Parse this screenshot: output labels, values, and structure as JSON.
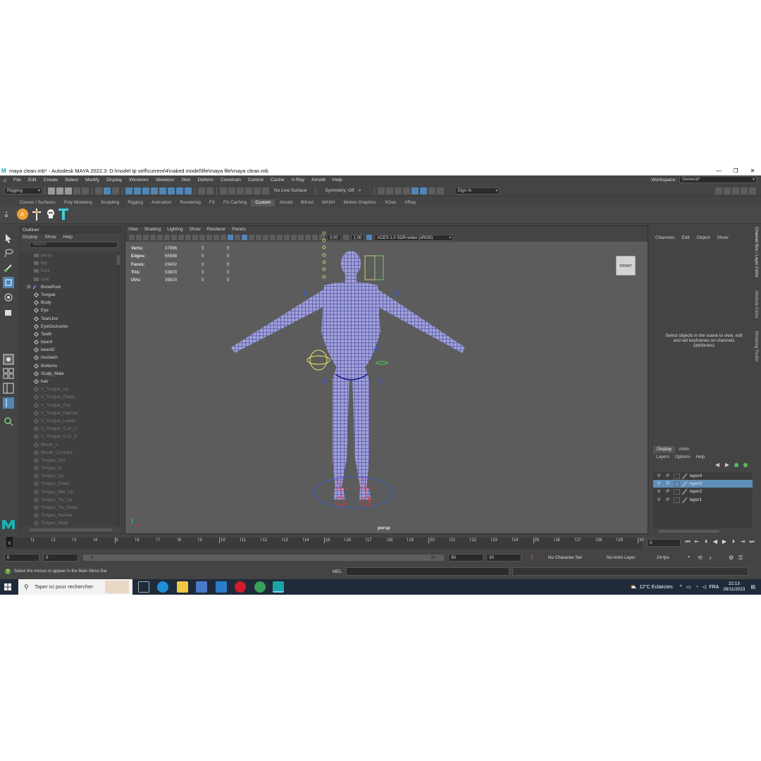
{
  "window": {
    "title": "maya clean.mb* - Autodesk MAYA 2022.3: D:\\model tp self\\current\\4\\naked model\\file\\maya file\\maya clean.mb",
    "controls": [
      "—",
      "❐",
      "✕"
    ]
  },
  "menubar": {
    "items": [
      "File",
      "Edit",
      "Create",
      "Select",
      "Modify",
      "Display",
      "Windows",
      "Skeleton",
      "Skin",
      "Deform",
      "Constrain",
      "Control",
      "Cache",
      "V-Ray",
      "Arnold",
      "Help"
    ],
    "workspace_label": "Workspace:",
    "workspace_value": "General*"
  },
  "statusline": {
    "menuset": "Rigging",
    "live_surface": "No Live Surface",
    "symmetry": "Symmetry: Off",
    "sign_in": "Sign In"
  },
  "shelf": {
    "tabs": [
      "Curves / Surfaces",
      "Poly Modeling",
      "Sculpting",
      "Rigging",
      "Animation",
      "Rendering",
      "FX",
      "FX Caching",
      "Custom",
      "Arnold",
      "Bifrost",
      "MASH",
      "Motion Graphics",
      "XGen",
      "VRay"
    ],
    "active_tab": "Custom"
  },
  "outliner": {
    "title": "Outliner",
    "menus": [
      "Display",
      "Show",
      "Help"
    ],
    "search_placeholder": "Search...",
    "items": [
      {
        "label": "persp",
        "kind": "camera",
        "dim": true
      },
      {
        "label": "top",
        "kind": "camera",
        "dim": true
      },
      {
        "label": "front",
        "kind": "camera",
        "dim": true
      },
      {
        "label": "side",
        "kind": "camera",
        "dim": true
      },
      {
        "label": "BoneRoot",
        "kind": "joint",
        "dim": false
      },
      {
        "label": "Tongue",
        "kind": "mesh",
        "dim": false
      },
      {
        "label": "Body",
        "kind": "mesh",
        "dim": false
      },
      {
        "label": "Eye",
        "kind": "mesh",
        "dim": false
      },
      {
        "label": "TearLine",
        "kind": "mesh",
        "dim": false
      },
      {
        "label": "EyeOcclusion",
        "kind": "mesh",
        "dim": false
      },
      {
        "label": "Teeth",
        "kind": "mesh",
        "dim": false
      },
      {
        "label": "beard",
        "kind": "mesh",
        "dim": false
      },
      {
        "label": "beard2",
        "kind": "mesh",
        "dim": false
      },
      {
        "label": "mustach",
        "kind": "mesh",
        "dim": false
      },
      {
        "label": "Bottoms",
        "kind": "mesh",
        "dim": false
      },
      {
        "label": "Scalp_Male",
        "kind": "mesh",
        "dim": false
      },
      {
        "label": "hair",
        "kind": "mesh",
        "dim": false
      },
      {
        "label": "V_Tongue_up",
        "kind": "mesh",
        "dim": true
      },
      {
        "label": "V_Tongue_Raise",
        "kind": "mesh",
        "dim": true
      },
      {
        "label": "V_Tongue_Out",
        "kind": "mesh",
        "dim": true
      },
      {
        "label": "V_Tongue_Narrow",
        "kind": "mesh",
        "dim": true
      },
      {
        "label": "V_Tongue_Lower",
        "kind": "mesh",
        "dim": true
      },
      {
        "label": "V_Tongue_Curl_U",
        "kind": "mesh",
        "dim": true
      },
      {
        "label": "V_Tongue_Curl_D",
        "kind": "mesh",
        "dim": true
      },
      {
        "label": "Mouth_L",
        "kind": "mesh",
        "dim": true
      },
      {
        "label": "Mouth_Contract",
        "kind": "mesh",
        "dim": true
      },
      {
        "label": "Tongue_Out",
        "kind": "mesh",
        "dim": true
      },
      {
        "label": "Tongue_In",
        "kind": "mesh",
        "dim": true
      },
      {
        "label": "Tongue_Up",
        "kind": "mesh",
        "dim": true
      },
      {
        "label": "Tongue_Down",
        "kind": "mesh",
        "dim": true
      },
      {
        "label": "Tongue_Mid_Up",
        "kind": "mesh",
        "dim": true
      },
      {
        "label": "Tongue_Tip_Up",
        "kind": "mesh",
        "dim": true
      },
      {
        "label": "Tongue_Tip_Down",
        "kind": "mesh",
        "dim": true
      },
      {
        "label": "Tongue_Narrow",
        "kind": "mesh",
        "dim": true
      },
      {
        "label": "Tongue_Wide",
        "kind": "mesh",
        "dim": true
      }
    ]
  },
  "viewport": {
    "menus": [
      "View",
      "Shading",
      "Lighting",
      "Show",
      "Renderer",
      "Panels"
    ],
    "exposure": "0.00",
    "gamma": "1.00",
    "color_space": "ACES 1.0 SDR-video (sRGB)",
    "camera": "persp",
    "viewcube": "FRONT",
    "hud": [
      {
        "label": "Verts:",
        "value": "37996",
        "a": "0",
        "b": "0"
      },
      {
        "label": "Edges:",
        "value": "65988",
        "a": "0",
        "b": "0"
      },
      {
        "label": "Faces:",
        "value": "29402",
        "a": "0",
        "b": "0"
      },
      {
        "label": "Tris:",
        "value": "53800",
        "a": "0",
        "b": "0"
      },
      {
        "label": "UVs:",
        "value": "39820",
        "a": "0",
        "b": "0"
      }
    ]
  },
  "channelbox": {
    "menus": [
      "Channels",
      "Edit",
      "Object",
      "Show"
    ],
    "hint": "Select objects in the scene to view, edit and set keyframes on channels (attributes)",
    "side_tabs": [
      "Channel Box / Layer Editor",
      "Attribute Editor",
      "Modeling Toolkit"
    ]
  },
  "layers": {
    "tabs": [
      "Display",
      "Anim"
    ],
    "menus": [
      "Layers",
      "Options",
      "Help"
    ],
    "rows": [
      {
        "v": "V",
        "p": "P",
        "name": "layer4",
        "selected": false
      },
      {
        "v": "V",
        "p": "P",
        "name": "layer3",
        "selected": true
      },
      {
        "v": "V",
        "p": "P",
        "name": "layer2",
        "selected": false
      },
      {
        "v": "V",
        "p": "P",
        "name": "layer1",
        "selected": false
      }
    ]
  },
  "timeline": {
    "ticks": [
      "1",
      "2",
      "3",
      "4",
      "5",
      "6",
      "7",
      "8",
      "9",
      "10",
      "11",
      "12",
      "13",
      "14",
      "15",
      "16",
      "17",
      "18",
      "19",
      "20",
      "21",
      "22",
      "23",
      "24",
      "25",
      "26",
      "27",
      "28",
      "29",
      "30"
    ],
    "labels": [
      "0",
      "5",
      "10",
      "15",
      "20",
      "25",
      "30"
    ],
    "current": "0",
    "frame_field": "0"
  },
  "range": {
    "start": "0",
    "anim_start": "0",
    "slider_start": "0",
    "slider_end": "30",
    "end": "30",
    "anim_end": "30",
    "character_set": "No Character Set",
    "anim_layer": "No Anim Layer",
    "fps": "24 fps"
  },
  "helpline": {
    "message": "Select the menus to appear in the Main Menu Bar",
    "mel": "MEL"
  },
  "taskbar": {
    "search_placeholder": "Taper ici pour rechercher",
    "weather": "12°C  Eclaircies",
    "lang": "FRA",
    "time": "22:13",
    "date": "26/11/2023"
  }
}
